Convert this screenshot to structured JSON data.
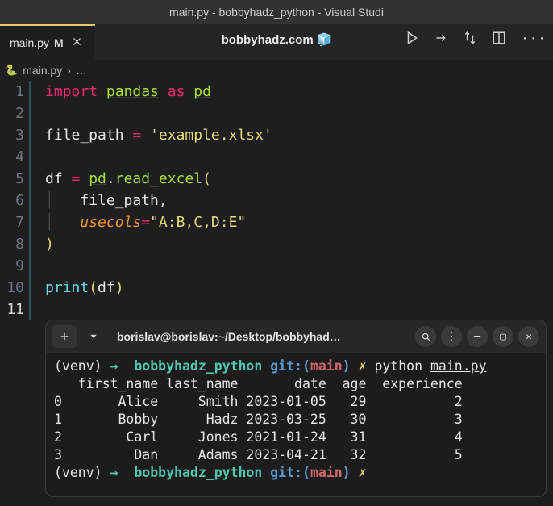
{
  "window": {
    "title": "main.py - bobbyhadz_python - Visual Studi"
  },
  "tab": {
    "filename": "main.py",
    "modified_marker": "M"
  },
  "watermark": {
    "text": "bobbyhadz.com",
    "emoji": "🧊"
  },
  "breadcrumb": {
    "file": "main.py",
    "sep": "›",
    "more": "…"
  },
  "line_numbers": [
    "1",
    "2",
    "3",
    "4",
    "5",
    "6",
    "7",
    "8",
    "9",
    "10",
    "11"
  ],
  "code": {
    "kw_import": "import",
    "mod_pandas": "pandas",
    "kw_as": "as",
    "alias_pd": "pd",
    "var_file_path": "file_path",
    "eq": "=",
    "str_example": "'example.xlsx'",
    "var_df": "df",
    "alias_pd2": "pd",
    "dot": ".",
    "fn_read_excel": "read_excel",
    "lparen": "(",
    "arg_file_path": "file_path",
    "comma": ",",
    "kw_usecols": "usecols",
    "str_cols": "\"A:B,C,D:E\"",
    "rparen": ")",
    "fn_print": "print",
    "arg_df": "df"
  },
  "terminal": {
    "title": "borislav@borislav:~/Desktop/bobbyhadz_...",
    "prompt": {
      "venv": "(venv)",
      "arrow": "→",
      "dir": "bobbyhadz_python",
      "git_label": "git:",
      "lparen": "(",
      "branch": "main",
      "rparen": ")",
      "x": "✗"
    },
    "command": {
      "py": "python",
      "file": "main.py"
    },
    "header": "   first_name last_name       date  age  experience",
    "rows": [
      "0       Alice     Smith 2023-01-05   29           2",
      "1       Bobby      Hadz 2023-03-25   30           3",
      "2        Carl     Jones 2021-01-24   31           4",
      "3         Dan     Adams 2023-04-21   32           5"
    ]
  }
}
